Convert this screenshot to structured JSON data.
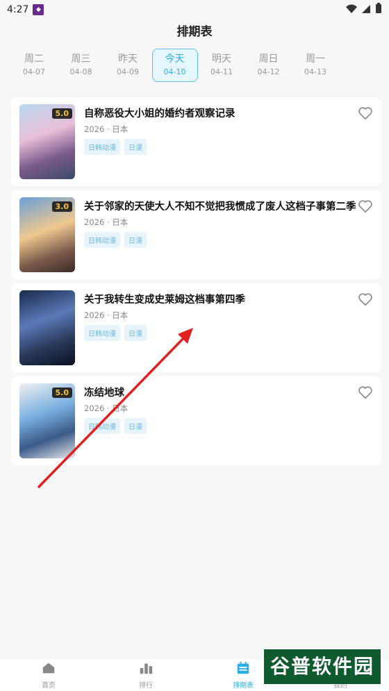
{
  "status_bar": {
    "time": "4:27"
  },
  "header": {
    "title": "排期表"
  },
  "date_tabs": [
    {
      "day": "周二",
      "date": "04-07",
      "active": false
    },
    {
      "day": "周三",
      "date": "04-08",
      "active": false
    },
    {
      "day": "昨天",
      "date": "04-09",
      "active": false
    },
    {
      "day": "今天",
      "date": "04-10",
      "active": true
    },
    {
      "day": "明天",
      "date": "04-11",
      "active": false
    },
    {
      "day": "周日",
      "date": "04-12",
      "active": false
    },
    {
      "day": "周一",
      "date": "04-13",
      "active": false
    }
  ],
  "anime_list": [
    {
      "title": "自称恶役大小姐的婚约者观察记录",
      "meta": "2026 · 日本",
      "score": "5.0",
      "tags": [
        "日韩动漫",
        "日漫"
      ]
    },
    {
      "title": "关于邻家的天使大人不知不觉把我惯成了废人这档子事第二季",
      "meta": "2026 · 日本",
      "score": "3.0",
      "tags": [
        "日韩动漫",
        "日漫"
      ]
    },
    {
      "title": "关于我转生变成史莱姆这档事第四季",
      "meta": "2026 · 日本",
      "score": "",
      "tags": [
        "日韩动漫",
        "日漫"
      ]
    },
    {
      "title": "冻结地球",
      "meta": "2026 · 日本",
      "score": "5.0",
      "tags": [
        "日韩动漫",
        "日漫"
      ]
    }
  ],
  "bottom_nav": [
    {
      "label": "首页",
      "icon": "home-icon",
      "active": false
    },
    {
      "label": "排行",
      "icon": "ranking-icon",
      "active": false
    },
    {
      "label": "排期表",
      "icon": "calendar-icon",
      "active": true
    },
    {
      "label": "我的",
      "icon": "profile-icon",
      "active": false
    }
  ],
  "watermark": {
    "text": "谷普软件园"
  },
  "colors": {
    "accent": "#28aee6",
    "tag_bg": "#e8f4fb",
    "score_text": "#f5c33b"
  }
}
